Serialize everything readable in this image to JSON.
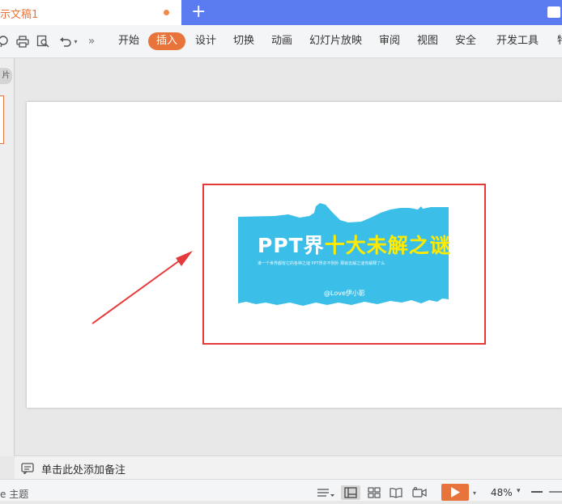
{
  "tab": {
    "title": "示文稿1"
  },
  "ribbon": {
    "menu": [
      "开始",
      "插入",
      "设计",
      "切换",
      "动画",
      "幻灯片放映",
      "审阅",
      "视图",
      "安全",
      "开发工具",
      "特"
    ],
    "active_menu": "插入",
    "more": "»"
  },
  "left_panel": {
    "button_glyph": "片"
  },
  "slide": {
    "banner": {
      "title_white_1": "PPT",
      "title_white_2": "界",
      "title_yellow": "十大未解之谜",
      "subtitle": "谁一个世界都有它的各种之谜 PPT界亦不例外 那就去解之谜你解释了么",
      "credit": "@Love伊小影"
    }
  },
  "notes": {
    "placeholder": "单击此处添加备注"
  },
  "statusbar": {
    "theme": "e 主题",
    "zoom": "48%",
    "zoom_caret": "▾"
  },
  "colors": {
    "accent": "#e8743b",
    "banner": "#3bbfe8",
    "highlight_box": "#e53a3a",
    "arrow": "#e53a3a",
    "tab_strip": "#5b7bf0"
  }
}
